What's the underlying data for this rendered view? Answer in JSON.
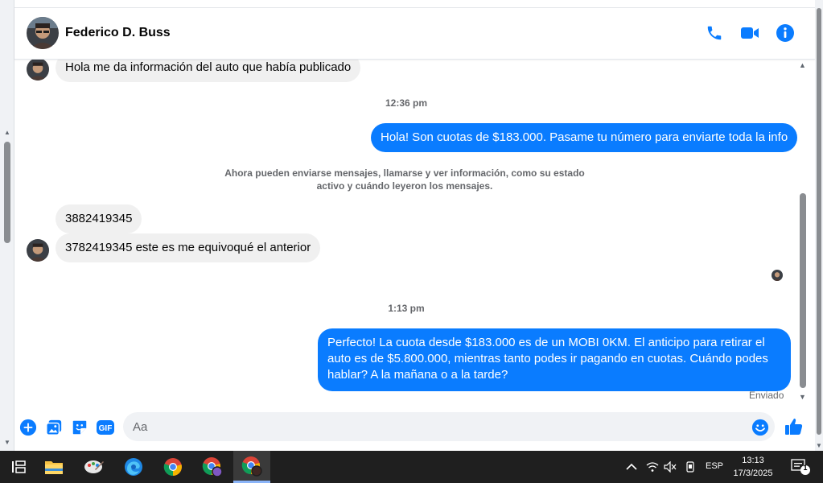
{
  "contact": {
    "name": "Federico D. Buss"
  },
  "header_actions": {
    "call_icon": "phone-icon",
    "video_icon": "video-icon",
    "info_icon": "info-icon",
    "accent_color": "#0a7cff"
  },
  "messages": [
    {
      "from": "contact",
      "text": "Hola me da información del auto que había publicado"
    },
    {
      "type": "timestamp",
      "text": "12:36 pm"
    },
    {
      "from": "me",
      "text": "Hola! Son cuotas de $183.000. Pasame tu número para enviarte toda la info"
    },
    {
      "type": "system",
      "text": "Ahora pueden enviarse mensajes, llamarse y ver información, como su estado activo y cuándo leyeron los mensajes."
    },
    {
      "from": "contact",
      "text": "3882419345"
    },
    {
      "from": "contact",
      "text": "3782419345 este es me equivoqué el anterior"
    },
    {
      "type": "timestamp",
      "text": "1:13 pm"
    },
    {
      "from": "me",
      "text": "Perfecto! La cuota desde $183.000 es de un MOBI 0KM. El anticipo para retirar el auto es de $5.800.000, mientras tanto podes ir pagando en cuotas. Cuándo podes hablar? A la mañana o a la tarde?"
    }
  ],
  "status": {
    "sent_label": "Enviado"
  },
  "composer": {
    "placeholder": "Aa",
    "buttons": [
      "plus-icon",
      "photo-icon",
      "sticker-icon",
      "gif-icon"
    ],
    "gif_label": "GIF"
  },
  "taskbar": {
    "apps": [
      "task-view-icon",
      "file-explorer-icon",
      "paint-icon",
      "edge-icon",
      "chrome-icon",
      "chrome-profile-icon",
      "chrome-profile-icon-active"
    ],
    "language": "ESP",
    "time": "13:13",
    "date": "17/3/2025",
    "notification_count": "1"
  }
}
